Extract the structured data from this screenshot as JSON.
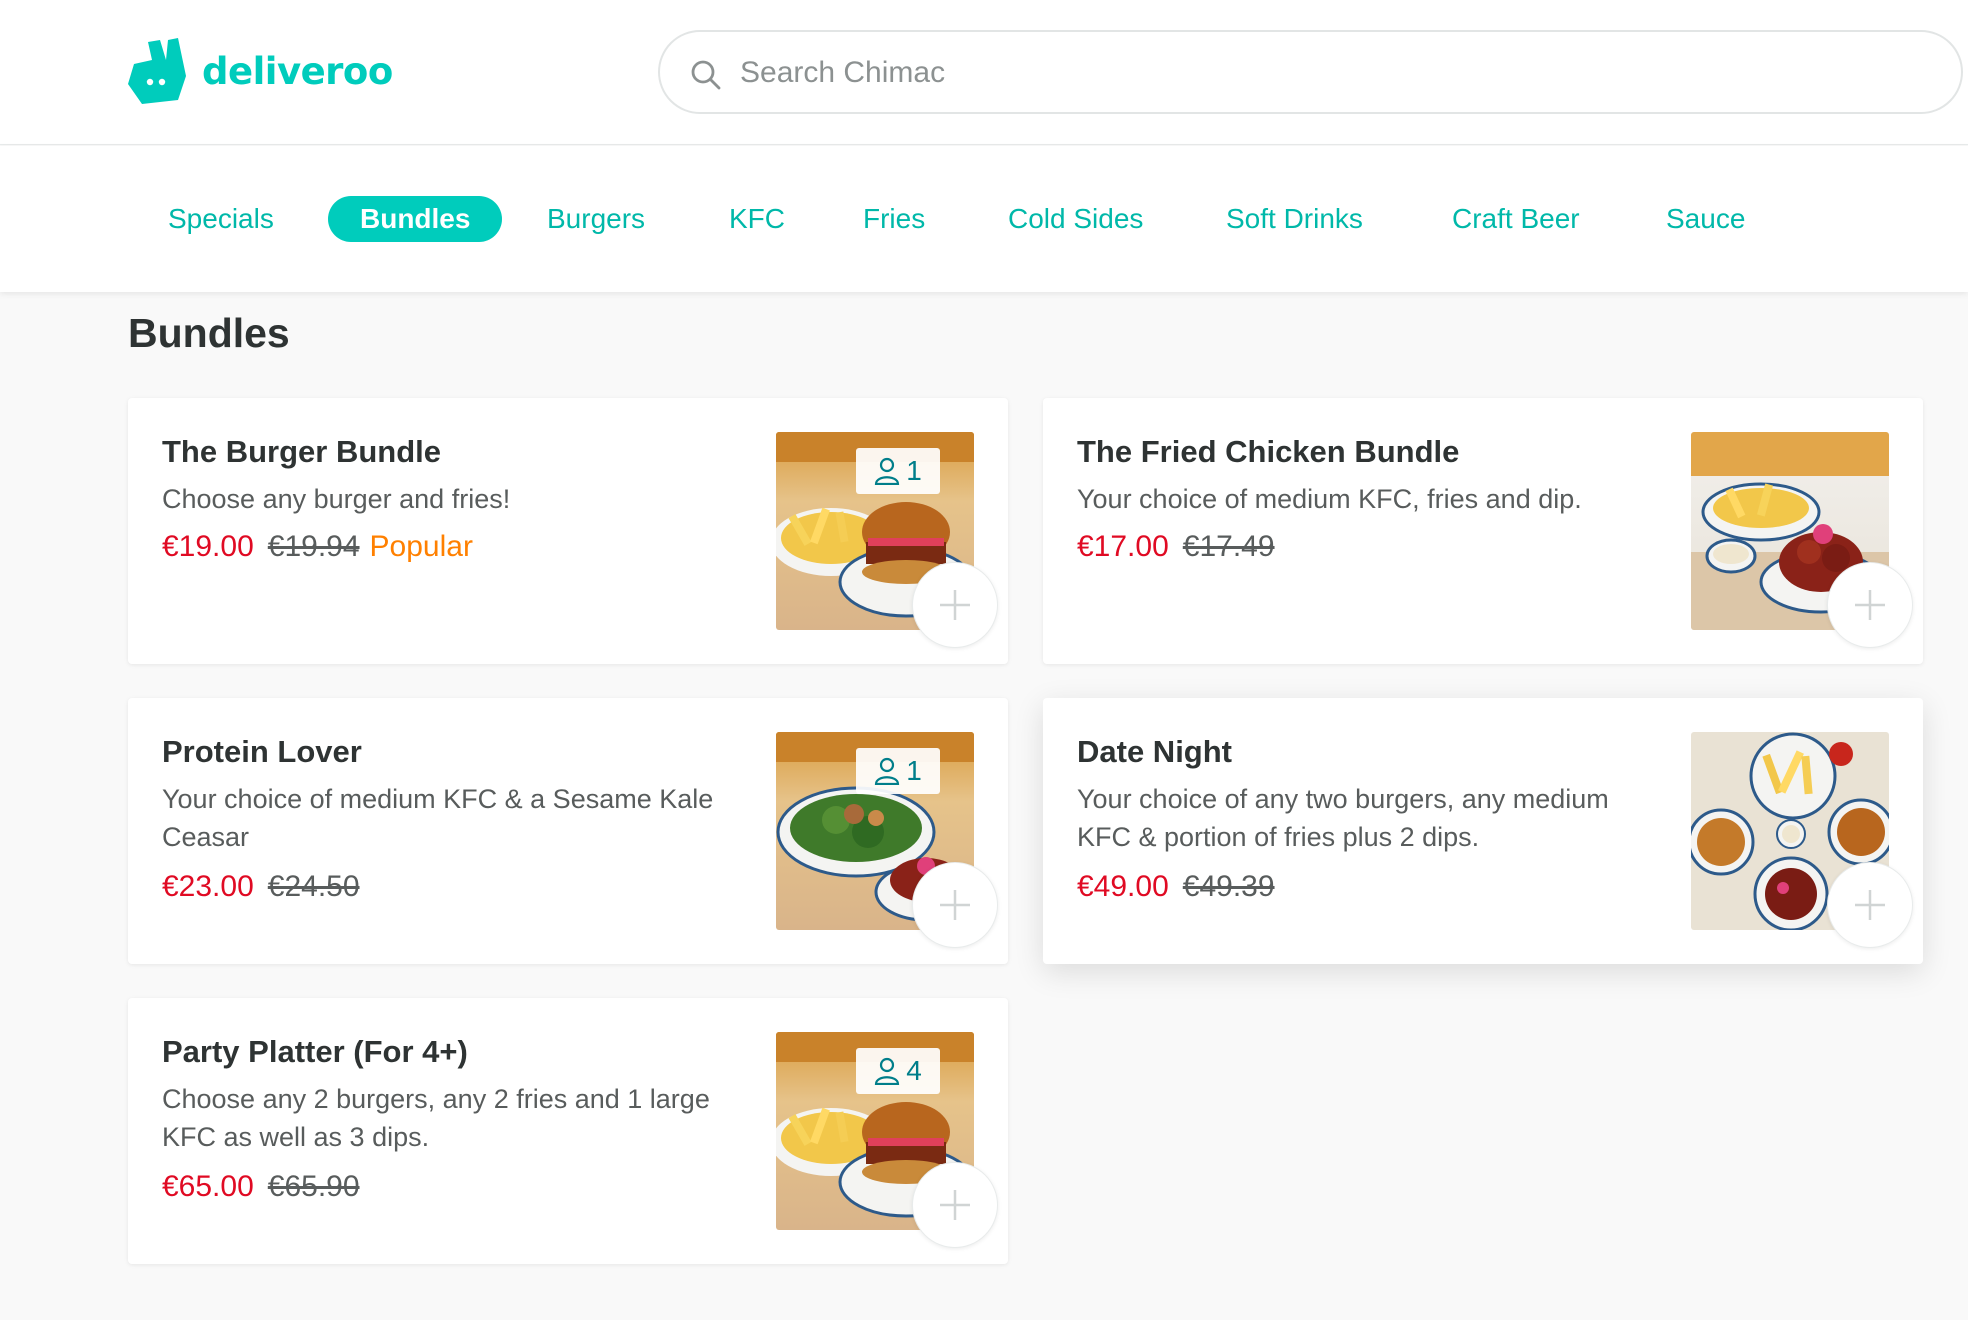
{
  "header": {
    "logo_text": "deliveroo",
    "search_placeholder": "Search Chimac"
  },
  "categories": [
    {
      "label": "Specials",
      "active": false
    },
    {
      "label": "Bundles",
      "active": true
    },
    {
      "label": "Burgers",
      "active": false
    },
    {
      "label": "KFC",
      "active": false
    },
    {
      "label": "Fries",
      "active": false
    },
    {
      "label": "Cold Sides",
      "active": false
    },
    {
      "label": "Soft Drinks",
      "active": false
    },
    {
      "label": "Craft Beer",
      "active": false
    },
    {
      "label": "Sauce",
      "active": false
    }
  ],
  "section": {
    "title": "Bundles"
  },
  "items": [
    {
      "name": "The Burger Bundle",
      "description": "Choose any burger and fries!",
      "price": "€19.00",
      "old_price": "€19.94",
      "badge": "Popular",
      "serves": "1",
      "image_icon": "burger-and-fries-photo"
    },
    {
      "name": "The Fried Chicken Bundle",
      "description": "Your choice of medium KFC, fries and dip.",
      "price": "€17.00",
      "old_price": "€17.49",
      "image_icon": "fried-chicken-and-fries-photo"
    },
    {
      "name": "Protein Lover",
      "description": "Your choice of medium KFC & a Sesame Kale Ceasar",
      "price": "€23.00",
      "old_price": "€24.50",
      "serves": "1",
      "image_icon": "kale-salad-and-chicken-photo"
    },
    {
      "name": "Date Night",
      "description": "Your choice of any two burgers, any medium KFC & portion of fries plus 2 dips.",
      "price": "€49.00",
      "old_price": "€49.39",
      "image_icon": "two-burgers-fries-chicken-photo"
    },
    {
      "name": "Party Platter (For 4+)",
      "description": "Choose any 2 burgers, any 2 fries and 1 large KFC as well as 3 dips.",
      "price": "€65.00",
      "old_price": "€65.90",
      "serves": "4",
      "image_icon": "burger-and-fries-photo"
    }
  ],
  "colors": {
    "brand": "#00ccbc",
    "price": "#e00a23",
    "popular": "#ff8000",
    "serves_badge": "#007e8a"
  }
}
